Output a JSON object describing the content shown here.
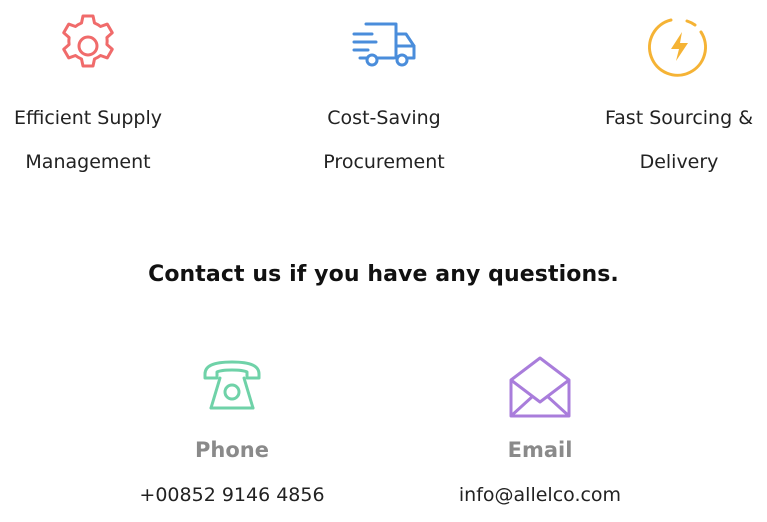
{
  "features": [
    {
      "icon": "gear-icon",
      "label_line1": "Efficient Supply",
      "label_line2": "Management",
      "color": "#f06b6b"
    },
    {
      "icon": "truck-icon",
      "label_line1": "Cost-Saving",
      "label_line2": "Procurement",
      "color": "#4a8ddb"
    },
    {
      "icon": "lightning-icon",
      "label_line1": "Fast Sourcing &",
      "label_line2": "Delivery",
      "color": "#f5b335"
    }
  ],
  "contact": {
    "title": "Contact us if you have any questions.",
    "phone": {
      "icon": "telephone-icon",
      "heading": "Phone",
      "value": "+00852 9146 4856",
      "color": "#6fd2a8"
    },
    "email": {
      "icon": "envelope-icon",
      "heading": "Email",
      "value": "info@allelco.com",
      "color": "#a97ddb"
    }
  }
}
